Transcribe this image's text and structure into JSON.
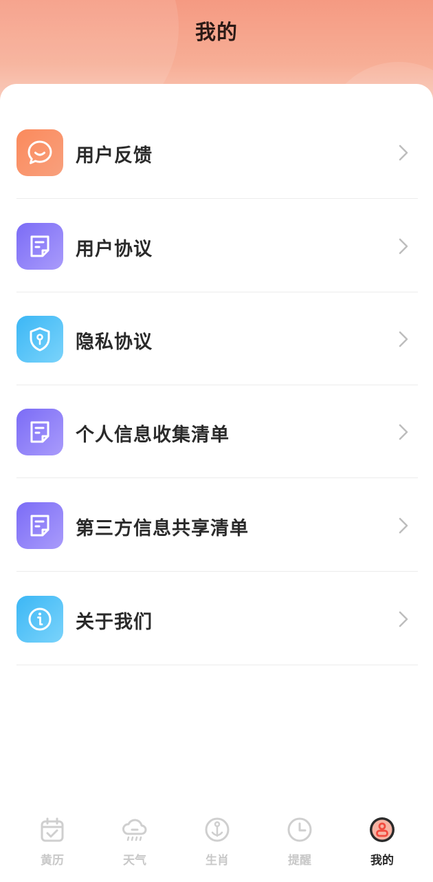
{
  "header": {
    "title": "我的"
  },
  "menu": [
    {
      "label": "用户反馈",
      "icon": "chat-bubble-icon",
      "color": "orange"
    },
    {
      "label": "用户协议",
      "icon": "document-icon",
      "color": "purple"
    },
    {
      "label": "隐私协议",
      "icon": "shield-icon",
      "color": "blue"
    },
    {
      "label": "个人信息收集清单",
      "icon": "document-icon",
      "color": "purple"
    },
    {
      "label": "第三方信息共享清单",
      "icon": "document-icon",
      "color": "purple"
    },
    {
      "label": "关于我们",
      "icon": "info-icon",
      "color": "blue"
    }
  ],
  "tabbar": {
    "items": [
      {
        "label": "黄历",
        "icon": "calendar-icon",
        "active": false
      },
      {
        "label": "天气",
        "icon": "cloud-rain-icon",
        "active": false
      },
      {
        "label": "生肖",
        "icon": "zodiac-icon",
        "active": false
      },
      {
        "label": "提醒",
        "icon": "clock-icon",
        "active": false
      },
      {
        "label": "我的",
        "icon": "user-icon",
        "active": true
      }
    ]
  },
  "colors": {
    "header_gradient_top": "#f59a82",
    "orange_icon": "#fb8a5c",
    "purple_icon": "#7b6cf6",
    "blue_icon": "#3cb7f5",
    "tab_inactive": "#c8c8c8",
    "tab_active": "#2b2b2b"
  }
}
